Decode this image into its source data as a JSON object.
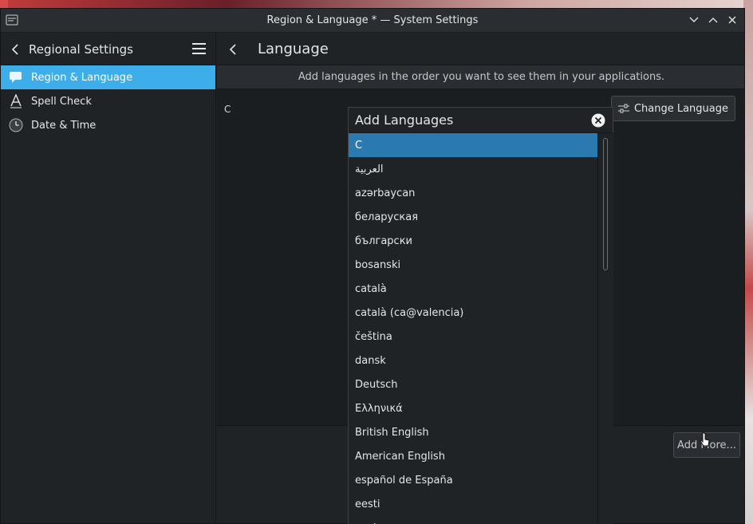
{
  "window": {
    "title": "Region & Language * — System Settings"
  },
  "sidebar": {
    "title": "Regional Settings",
    "items": [
      {
        "label": "Region & Language",
        "icon": "speech-bubble-icon",
        "active": true
      },
      {
        "label": "Spell Check",
        "icon": "spellcheck-a-icon",
        "active": false
      },
      {
        "label": "Date & Time",
        "icon": "clock-icon",
        "active": false
      }
    ]
  },
  "main": {
    "title": "Language",
    "subtitle": "Add languages in the order you want to see them in your applications.",
    "current_language": "C",
    "change_language_label": "Change Language",
    "add_more_label": "Add More..."
  },
  "dialog": {
    "title": "Add Languages",
    "languages": [
      "C",
      "العربية",
      "azərbaycan",
      "беларуская",
      "български",
      "bosanski",
      "català",
      "català (ca@valencia)",
      "čeština",
      "dansk",
      "Deutsch",
      "Ελληνικά",
      "British English",
      "American English",
      "español de España",
      "eesti",
      "euskara"
    ],
    "selected_index": 0
  },
  "colors": {
    "accent": "#3daee9",
    "selected": "#2a7ab0",
    "window_bg": "#202326",
    "content_bg": "#1b1e20"
  }
}
